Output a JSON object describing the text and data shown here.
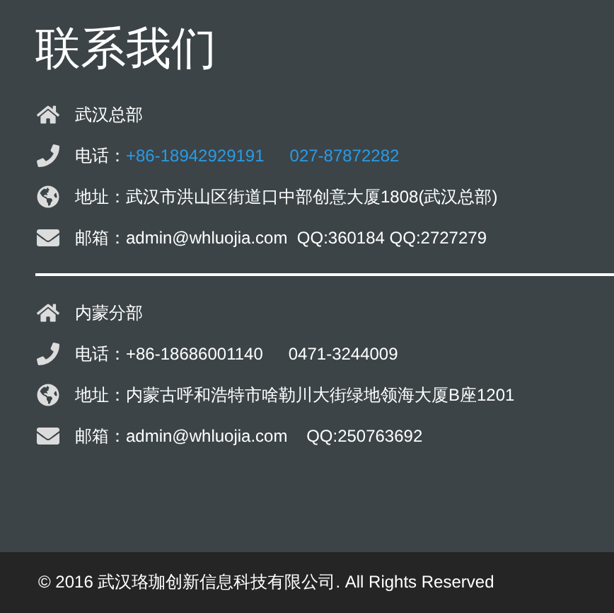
{
  "title": "联系我们",
  "offices": [
    {
      "name": "武汉总部",
      "phone": {
        "label": "电话：",
        "numbers": [
          {
            "text": "+86-18942929191",
            "linked": true
          },
          {
            "text": "027-87872282",
            "linked": true
          }
        ]
      },
      "address": {
        "label": "地址：",
        "text": "武汉市洪山区街道口中部创意大厦1808(武汉总部)"
      },
      "email": {
        "label": "邮箱：",
        "text": "admin@whluojia.com  QQ:360184 QQ:2727279"
      }
    },
    {
      "name": "内蒙分部",
      "phone": {
        "label": "电话：",
        "numbers": [
          {
            "text": "+86-18686001140",
            "linked": false
          },
          {
            "text": "0471-3244009",
            "linked": false
          }
        ]
      },
      "address": {
        "label": "地址：",
        "text": "内蒙古呼和浩特市啥勒川大街绿地领海大厦B座1201"
      },
      "email": {
        "label": "邮箱：",
        "text": "admin@whluojia.com    QQ:250763692"
      }
    }
  ],
  "footer": "© 2016 武汉珞珈创新信息科技有限公司. All Rights Reserved"
}
